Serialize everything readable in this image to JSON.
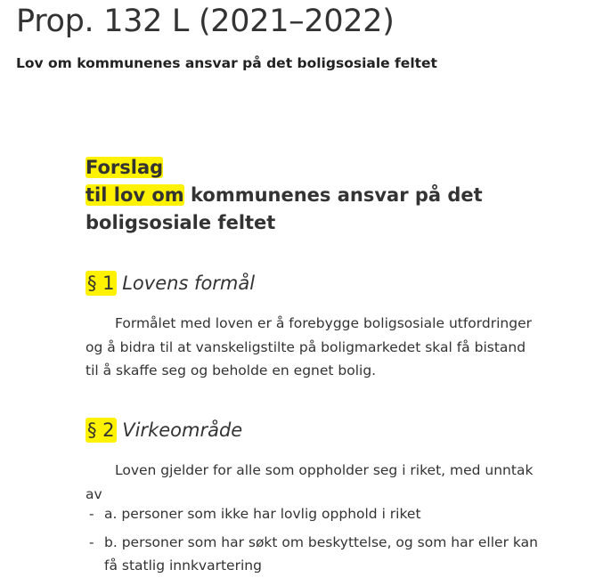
{
  "document": {
    "title": "Prop. 132 L (2021–2022)",
    "subtitle": "Lov om kommunenes ansvar på det boligsosiale feltet"
  },
  "law_heading": {
    "line1": "Forslag",
    "line2_highlight": "til lov om",
    "line2_rest": " kommunenes ansvar på det",
    "line3": "boligsosiale feltet"
  },
  "sections": [
    {
      "number": "§ 1",
      "title": "Lovens formål",
      "text": "Formålet med loven er å forebygge boligsosiale utfordringer og å bidra til at vanskeligstilte på boligmarkedet skal få bistand til å skaffe seg og beholde en egnet bolig."
    },
    {
      "number": "§ 2",
      "title": "Virkeområde",
      "text": "Loven gjelder for alle som oppholder seg i riket, med unntak av",
      "list": [
        "a. personer som ikke har lovlig opphold i riket",
        "b. personer som har søkt om beskyttelse, og som har eller kan få statlig innkvartering"
      ]
    }
  ],
  "list_marker": "-",
  "colors": {
    "highlight": "#fff200",
    "text": "#333333"
  }
}
